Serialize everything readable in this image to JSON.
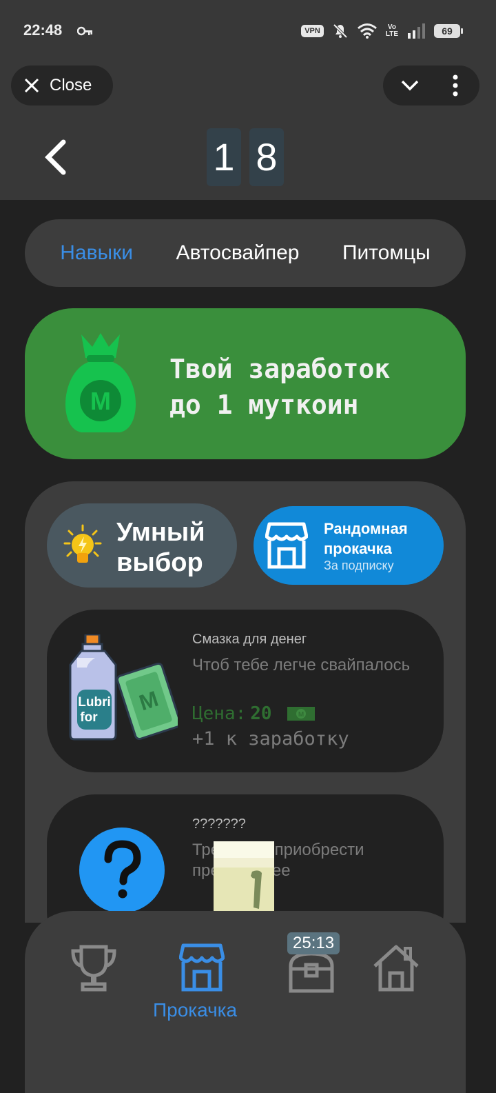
{
  "status_bar": {
    "time": "22:48",
    "vpn": "VPN",
    "network": "Vo LTE",
    "battery": "69"
  },
  "webview": {
    "close_label": "Close"
  },
  "header": {
    "digits": [
      "1",
      "8"
    ]
  },
  "tabs": [
    {
      "label": "Навыки",
      "active": true
    },
    {
      "label": "Автосвайпер",
      "active": false
    },
    {
      "label": "Питомцы",
      "active": false
    }
  ],
  "earnings": {
    "line1": "Твой заработок",
    "line2": "до 1 муткоин"
  },
  "smart_choice": {
    "line1": "Умный",
    "line2": "выбор"
  },
  "random_upgrade": {
    "line1": "Рандомная",
    "line2": "прокачка",
    "sub": "За подписку"
  },
  "cards": [
    {
      "name": "Смазка для денег",
      "desc": "Чтоб тебе легче свайпалось",
      "price_label": "Цена:",
      "price": "20",
      "bonus": "+1 к заработку",
      "jug_label_1": "Lubri",
      "jug_label_2": "for"
    },
    {
      "name": "???????",
      "desc": "Требуется приобрести предыдущее"
    }
  ],
  "bottom_nav": {
    "active_label": "Прокачка",
    "timer": "25:13"
  },
  "colors": {
    "accent": "#3a8ee6",
    "green": "#3a8f3c",
    "blue": "#1189d8"
  }
}
